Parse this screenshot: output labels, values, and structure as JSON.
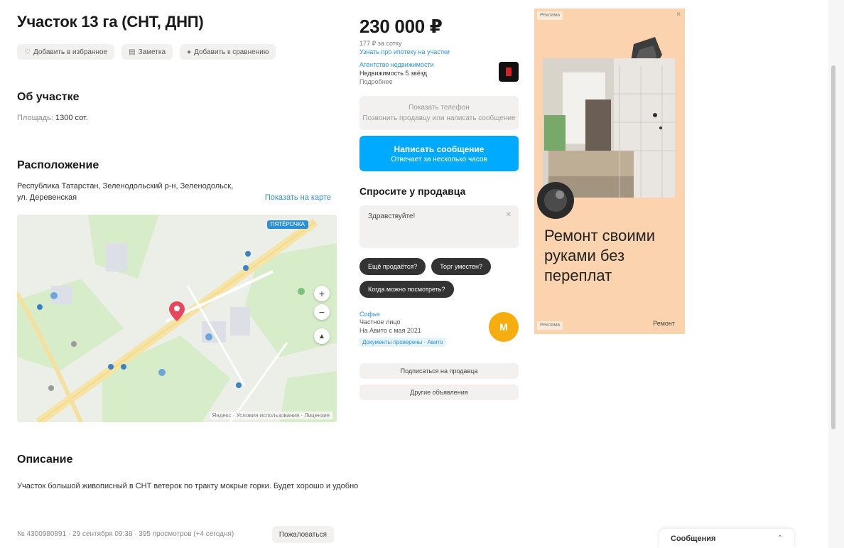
{
  "listing": {
    "title": "Участок 13 га (СНТ, ДНП)",
    "actions": [
      {
        "icon": "heart-icon",
        "label": "Добавить в избранное"
      },
      {
        "icon": "note-icon",
        "label": "Заметка"
      },
      {
        "icon": "compare-icon",
        "label": "Добавить к сравнению"
      }
    ]
  },
  "about": {
    "heading": "Об участке",
    "param_label": "Площадь:",
    "param_value": "1300 сот."
  },
  "location": {
    "heading": "Расположение",
    "address": "Республика Татарстан, Зеленодольский р-н, Зеленодольск, ул. Деревенская",
    "map_link": "Показать на карте",
    "map_badge": "ПЯТЁРОЧКА",
    "zoom_in": "+",
    "zoom_out": "−",
    "locate": "▲",
    "attribution": "Яндекс · Условия использования · Лицензия"
  },
  "description": {
    "heading": "Описание",
    "text": "Участок большой живописный в СНТ ветерок по тракту мокрые горки. Будет хорошо и удобно"
  },
  "footer": {
    "meta": "№ 4300980891 · 29 сентября 09:38 · 395 просмотров (+4 сегодня)",
    "report_button": "Пожаловаться"
  },
  "sidebar": {
    "price": "230 000 ₽",
    "price_note": "177 ₽ за сотку",
    "mortgage_link": "Узнать про ипотеку на участки",
    "agency_label": "Агентство недвижимости",
    "agency_name": "Недвижимость 5 звёзд",
    "agency_sub": "Подробнее",
    "phone_title": "Показать телефон",
    "phone_subtitle": "Позвонить продавцу или написать сообщение",
    "write_title": "Написать сообщение",
    "write_subtitle": "Отвечает за несколько часов",
    "ask_title": "Спросите у продавца",
    "message_placeholder": "Здравствуйте!",
    "quick_replies": [
      "Ещё продаётся?",
      "Торг уместен?",
      "Когда можно посмотреть?"
    ],
    "seller_name": "Софья",
    "seller_type": "Частное лицо",
    "seller_since": "На Авито с мая 2021",
    "seller_badge": "Документы проверены · Авито",
    "seller_initials": "М",
    "subscribe_button": "Подписаться на продавца",
    "other_ads_button": "Другие объявления"
  },
  "ad": {
    "label": "Реклама",
    "close": "×",
    "headline": "Ремонт своими руками без переплат",
    "footer_left": "Реклама",
    "footer_right": "Ремонт"
  },
  "chat": {
    "label": "Сообщения",
    "arrow": "⌃"
  }
}
